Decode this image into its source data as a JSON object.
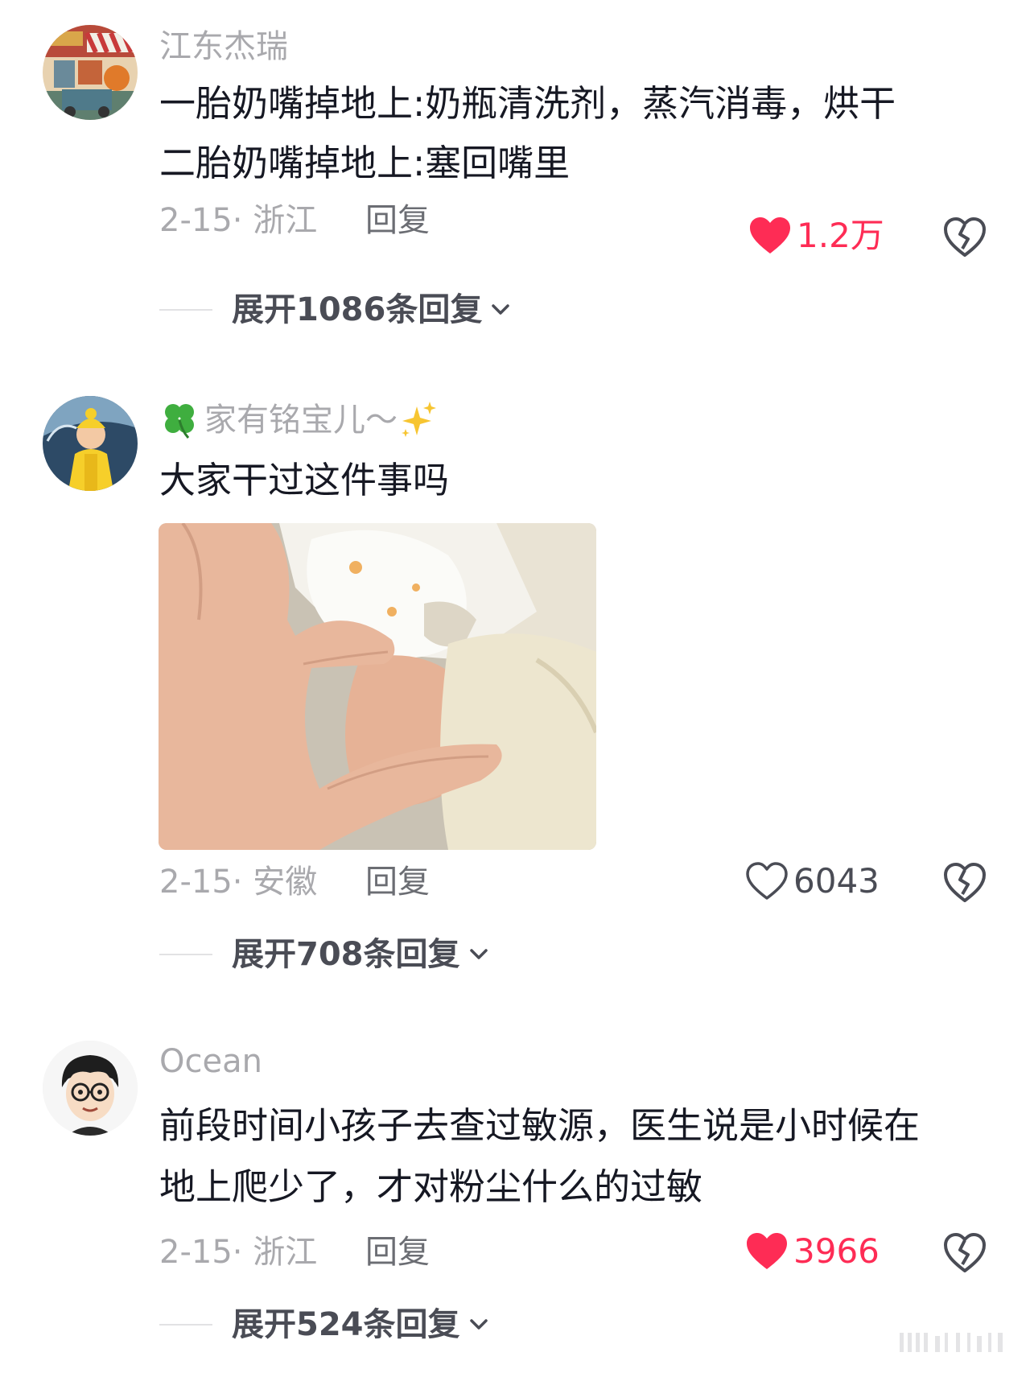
{
  "comments": [
    {
      "username": "江东杰瑞",
      "lines": [
        "一胎奶嘴掉地上:奶瓶清洗剂，蒸汽消毒，烘干",
        "二胎奶嘴掉地上:塞回嘴里"
      ],
      "date_location": "2-15· 浙江",
      "reply_label": "回复",
      "like_count": "1.2万",
      "liked": true,
      "expand_label": "展开1086条回复"
    },
    {
      "username_prefix_icon": "four-leaf-clover-icon",
      "username": "家有铭宝儿～",
      "username_suffix_icon": "sparkles-icon",
      "lines": [
        "大家干过这件事吗"
      ],
      "has_image": true,
      "date_location": "2-15· 安徽",
      "reply_label": "回复",
      "like_count": "6043",
      "liked": false,
      "expand_label": "展开708条回复"
    },
    {
      "username": "Ocean",
      "lines": [
        "前段时间小孩子去查过敏源，医生说是小时候在",
        "地上爬少了，才对粉尘什么的过敏"
      ],
      "date_location": "2-15· 浙江",
      "reply_label": "回复",
      "like_count": "3966",
      "liked": true,
      "expand_label": "展开524条回复"
    }
  ],
  "colors": {
    "liked_red": "#fe2c55",
    "muted_gray": "#a9a9ad",
    "text_dark": "#161823"
  }
}
